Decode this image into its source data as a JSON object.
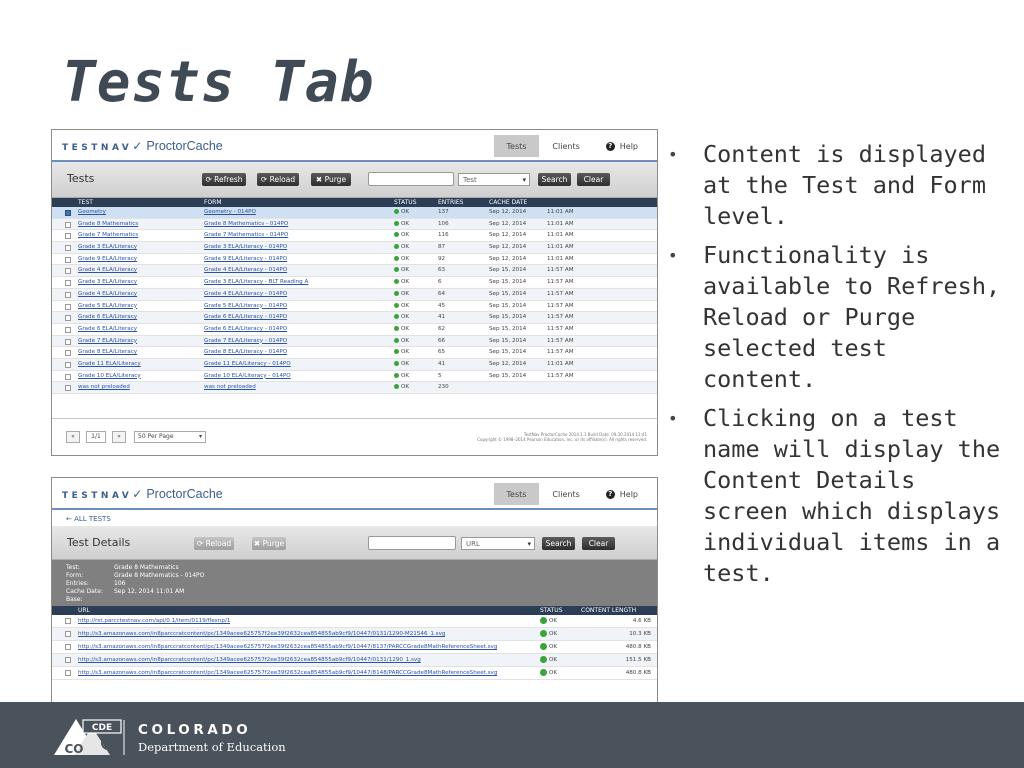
{
  "slide": {
    "title": "Tests Tab",
    "bullets": [
      "Content is displayed at the Test and Form level.",
      "Functionality is available to Refresh, Reload or Purge selected test content.",
      "Clicking on a test name will display the Content Details screen which displays individual items in a test."
    ]
  },
  "footer": {
    "emblem_text": [
      "CDE",
      "CO"
    ],
    "org_line1": "COLORADO",
    "org_line2": "Department of Education"
  },
  "app": {
    "logo_text": "TESTNAV",
    "logo_check": "✓",
    "product": "ProctorCache",
    "nav": {
      "tests": "Tests",
      "clients": "Clients",
      "help": "Help",
      "help_icon": "?"
    }
  },
  "tests_screen": {
    "toolbar": {
      "title": "Tests",
      "refresh": "⟳ Refresh",
      "reload": "⟳ Reload",
      "purge": "✖ Purge",
      "search_value": "",
      "filter_value": "Test",
      "search": "Search",
      "clear": "Clear"
    },
    "columns": [
      "TEST",
      "FORM",
      "STATUS",
      "ENTRIES",
      "CACHE DATE"
    ],
    "rows": [
      {
        "test": "Geometry",
        "form": "Geometry - 014PO",
        "status": "OK",
        "entries": "137",
        "date": "Sep 12, 2014",
        "time": "11:01 AM",
        "checked": true
      },
      {
        "test": "Grade 8 Mathematics",
        "form": "Grade 8 Mathematics - 014PO",
        "status": "OK",
        "entries": "106",
        "date": "Sep 12, 2014",
        "time": "11:01 AM",
        "checked": false
      },
      {
        "test": "Grade 7 Mathematics",
        "form": "Grade 7 Mathematics - 014PO",
        "status": "OK",
        "entries": "116",
        "date": "Sep 12, 2014",
        "time": "11:01 AM",
        "checked": false
      },
      {
        "test": "Grade 3 ELA/Literacy",
        "form": "Grade 3 ELA/Literacy - 014PO",
        "status": "OK",
        "entries": "87",
        "date": "Sep 12, 2014",
        "time": "11:01 AM",
        "checked": false
      },
      {
        "test": "Grade 9 ELA/Literacy",
        "form": "Grade 9 ELA/Literacy - 014PO",
        "status": "OK",
        "entries": "92",
        "date": "Sep 12, 2014",
        "time": "11:01 AM",
        "checked": false
      },
      {
        "test": "Grade 4 ELA/Literacy",
        "form": "Grade 4 ELA/Literacy - 014PO",
        "status": "OK",
        "entries": "63",
        "date": "Sep 15, 2014",
        "time": "11:57 AM",
        "checked": false
      },
      {
        "test": "Grade 3 ELA/Literacy",
        "form": "Grade 3 ELA/Literacy - BLT Reading A",
        "status": "OK",
        "entries": "6",
        "date": "Sep 15, 2014",
        "time": "11:57 AM",
        "checked": false
      },
      {
        "test": "Grade 4 ELA/Literacy",
        "form": "Grade 4 ELA/Literacy - 014PO",
        "status": "OK",
        "entries": "64",
        "date": "Sep 15, 2014",
        "time": "11:57 AM",
        "checked": false
      },
      {
        "test": "Grade 5 ELA/Literacy",
        "form": "Grade 5 ELA/Literacy - 014PO",
        "status": "OK",
        "entries": "45",
        "date": "Sep 15, 2014",
        "time": "11:57 AM",
        "checked": false
      },
      {
        "test": "Grade 6 ELA/Literacy",
        "form": "Grade 6 ELA/Literacy - 014PO",
        "status": "OK",
        "entries": "41",
        "date": "Sep 15, 2014",
        "time": "11:57 AM",
        "checked": false
      },
      {
        "test": "Grade 6 ELA/Literacy",
        "form": "Grade 6 ELA/Literacy - 014PO",
        "status": "OK",
        "entries": "62",
        "date": "Sep 15, 2014",
        "time": "11:57 AM",
        "checked": false
      },
      {
        "test": "Grade 7 ELA/Literacy",
        "form": "Grade 7 ELA/Literacy - 014PO",
        "status": "OK",
        "entries": "66",
        "date": "Sep 15, 2014",
        "time": "11:57 AM",
        "checked": false
      },
      {
        "test": "Grade 8 ELA/Literacy",
        "form": "Grade 8 ELA/Literacy - 014PO",
        "status": "OK",
        "entries": "65",
        "date": "Sep 15, 2014",
        "time": "11:57 AM",
        "checked": false
      },
      {
        "test": "Grade 11 ELA/Literacy",
        "form": "Grade 11 ELA/Literacy - 014PO",
        "status": "OK",
        "entries": "41",
        "date": "Sep 12, 2014",
        "time": "11:01 AM",
        "checked": false
      },
      {
        "test": "Grade 10 ELA/Literacy",
        "form": "Grade 10 ELA/Literacy - 014PO",
        "status": "OK",
        "entries": "5",
        "date": "Sep 15, 2014",
        "time": "11:57 AM",
        "checked": false
      },
      {
        "test": "was not preloaded",
        "form": "was not preloaded",
        "status": "OK",
        "entries": "230",
        "date": "",
        "time": "",
        "checked": false
      }
    ],
    "pager": {
      "first": "«",
      "page": "1/1",
      "next": "»",
      "per_page": "50 Per Page"
    },
    "copyright_lines": [
      "TestNav ProctorCache 2014.1.1 Build Date: 09.30.2014 11:41",
      "Copyright © 1998–2014 Pearson Education, Inc. or its affiliate(s). All rights reserved."
    ]
  },
  "details_screen": {
    "breadcrumb": "← ALL TESTS",
    "toolbar": {
      "title": "Test Details",
      "reload": "⟳ Reload",
      "purge": "✖ Purge",
      "search_value": "",
      "filter_value": "URL",
      "search": "Search",
      "clear": "Clear"
    },
    "info": [
      {
        "label": "Test:",
        "value": "Grade 8 Mathematics"
      },
      {
        "label": "Form:",
        "value": "Grade 8 Mathematics - 014PO"
      },
      {
        "label": "Entries:",
        "value": "106"
      },
      {
        "label": "Cache Date:",
        "value": "Sep 12, 2014        11:01 AM"
      },
      {
        "label": "Base:",
        "value": ""
      }
    ],
    "columns": [
      "URL",
      "STATUS",
      "CONTENT LENGTH"
    ],
    "rows": [
      {
        "url": "http://rst.parcctestnav.com/api/0.1/item/0119/flexnp/1",
        "status": "OK",
        "length": "4.6 KB"
      },
      {
        "url": "http://s3.amazonaws.com/in8parccratcontent/pc/1349acee625757f2ee39f2632cea854855ab9cf9/10447/0131/1290-M21546_1.svg",
        "status": "OK",
        "length": "10.3 KB"
      },
      {
        "url": "http://s3.amazonaws.com/in8parccratcontent/pc/1349acee625757f2ee39f2632cea854855ab9cf9/10447/8137/PARCCGrade8MathReferenceSheet.svg",
        "status": "OK",
        "length": "480.8 KB"
      },
      {
        "url": "http://s3.amazonaws.com/in8parccratcontent/pc/1349acee625757f2ee39f2632cea854855ab9cf9/10447/0131/1290_1.svg",
        "status": "OK",
        "length": "151.5 KB"
      },
      {
        "url": "http://s3.amazonaws.com/in8parccratcontent/pc/1349acee625757f2ee39f2632cea854855ab9cf9/10447/8148/PARCCGrade8MathReferenceSheet.svg",
        "status": "OK",
        "length": "480.8 KB"
      }
    ]
  },
  "colors": {
    "title": "#3f4a55",
    "footer": "#4a525b",
    "header_bar": "#2c3e55",
    "link": "#2a52a8",
    "status_ok": "#3aa33a"
  }
}
